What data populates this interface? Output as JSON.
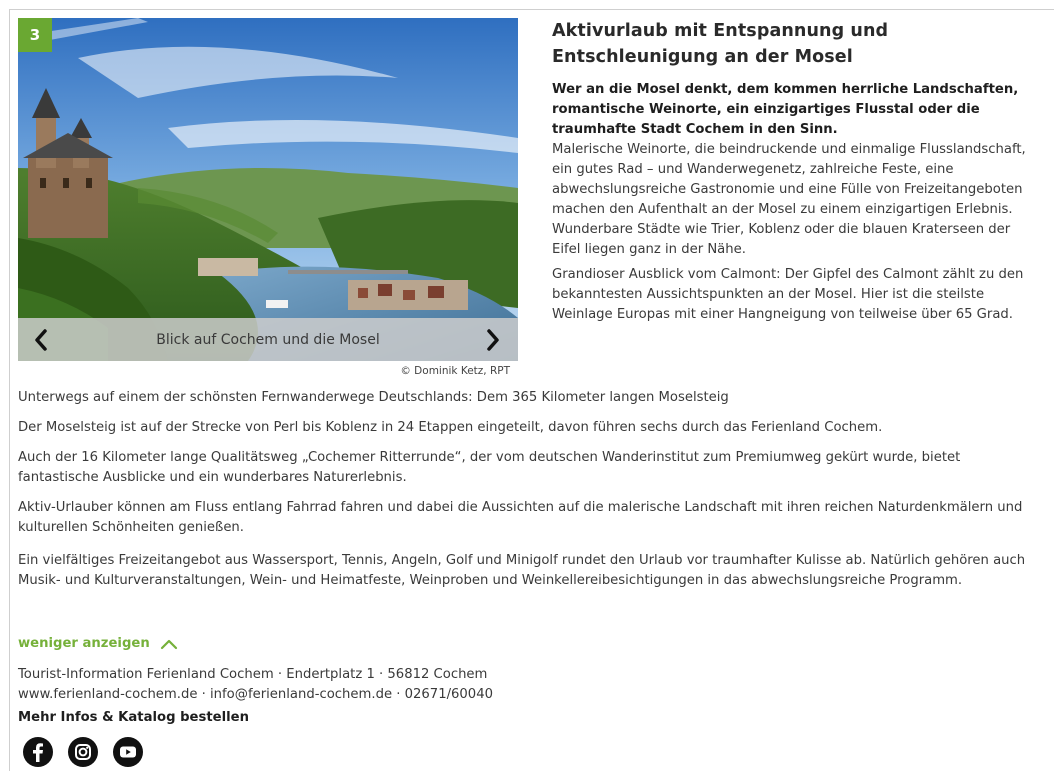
{
  "slider": {
    "badge": "3",
    "caption": "Blick auf Cochem und die Mosel",
    "copyright": "© Dominik Ketz, RPT",
    "prev_icon": "chevron-left-icon",
    "next_icon": "chevron-right-icon"
  },
  "article": {
    "title": "Aktivurlaub mit Entspannung und Entschleunigung an der Mosel",
    "lead": "Wer an die Mosel denkt, dem kommen herrliche Landschaften, romantische Weinorte, ein einzigartiges Flusstal oder die traumhafte Stadt Cochem in den Sinn.",
    "para1": "Malerische Weinorte, die beindruckende und einmalige Flusslandschaft, ein gutes Rad – und Wanderwegenetz, zahlreiche Feste, eine abwechslungsreiche Gastronomie und eine Fülle von Freizeitangeboten machen den Aufenthalt an der Mosel zu einem einzigartigen Erlebnis. Wunderbare Städte wie Trier, Koblenz oder die blauen Kraterseen der Eifel liegen ganz in der Nähe.",
    "para2": "Grandioser Ausblick vom Calmont: Der Gipfel des Calmont zählt zu den bekanntesten Aussichtspunkten an der Mosel. Hier ist die steilste Weinlage Europas mit einer Hangneigung von teilweise über 65 Grad.",
    "para3": "Unterwegs auf einem der schönsten Fernwanderwege Deutschlands: Dem 365 Kilometer langen Moselsteig",
    "para4": "Der Moselsteig ist auf der Strecke von Perl bis Koblenz in 24 Etappen eingeteilt, davon führen sechs durch das Ferienland Cochem.",
    "para5": "Auch der 16 Kilometer lange Qualitätsweg „Cochemer Ritterrunde“, der vom deutschen Wanderinstitut zum Premiumweg gekürt wurde, bietet fantastische Ausblicke und ein wunderbares Naturerlebnis.",
    "para6": "Aktiv-Urlauber können am Fluss entlang Fahrrad fahren und dabei die Aussichten auf die malerische Landschaft mit ihren reichen Naturdenkmälern und kulturellen Schönheiten genießen.",
    "para7": "Ein vielfältiges Freizeitangebot aus Wassersport, Tennis, Angeln, Golf und Minigolf rundet den Urlaub vor traumhafter Kulisse ab. Natürlich gehören auch Musik- und Kulturveranstaltungen, Wein- und Heimatfeste, Weinproben und Weinkellereibesichtigungen in das abwechslungsreiche Programm."
  },
  "toggle": {
    "label": "weniger anzeigen",
    "icon": "chevron-up-icon",
    "color": "#76b13a"
  },
  "contact": {
    "line1": "Tourist-Information Ferienland Cochem · Endertplatz 1 · 56812 Cochem",
    "line2": "www.ferienland-cochem.de · info@ferienland-cochem.de · 02671/60040",
    "catalog": "Mehr Infos & Katalog bestellen"
  },
  "social": [
    {
      "name": "facebook-icon"
    },
    {
      "name": "instagram-icon"
    },
    {
      "name": "youtube-icon"
    }
  ],
  "colors": {
    "accent": "#6aa832",
    "text": "#3a3a3a"
  }
}
